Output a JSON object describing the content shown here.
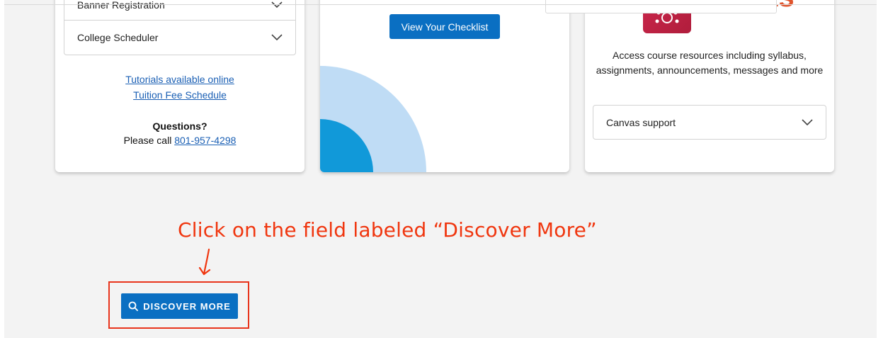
{
  "left_card": {
    "accordions": [
      {
        "label": "Banner Registration"
      },
      {
        "label": "College Scheduler"
      }
    ],
    "links": [
      "Tutorials available online",
      "Tuition Fee Schedule"
    ],
    "questions_heading": "Questions?",
    "call_text": "Please call",
    "phone": "801-957-4298"
  },
  "middle_card": {
    "button_label": "View Your Checklist",
    "decor_colors": {
      "outer": "#bfdcf5",
      "inner": "#1199d9"
    }
  },
  "right_card": {
    "logo_word": "canvas",
    "description": "Access course resources including syllabus, assignments, announcements, messages and more",
    "accordion_label": "Canvas support"
  },
  "annotation": {
    "instruction": "Click on the field labeled “Discover More”",
    "color": "#f0360f"
  },
  "discover_button": {
    "label": "DISCOVER MORE",
    "icon": "search-icon",
    "color": "#0a6fc2"
  }
}
